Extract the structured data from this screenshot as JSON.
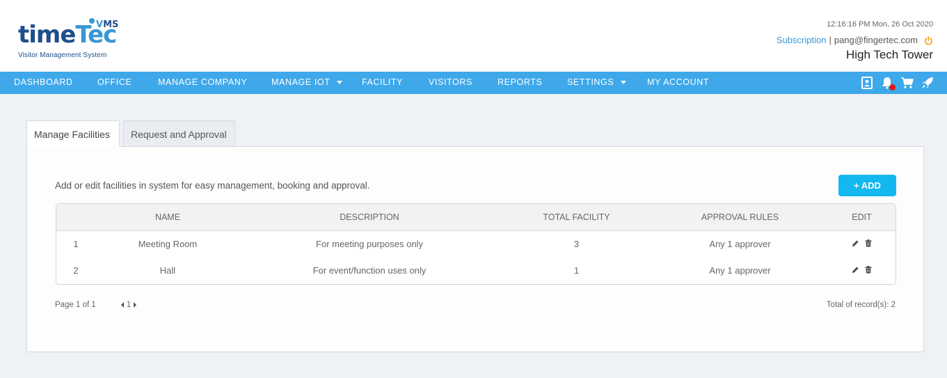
{
  "logo": {
    "time": "time",
    "tec": "Tec",
    "vms_v": "V",
    "vms_ms": "MS",
    "tagline": "Visitor Management System"
  },
  "header": {
    "datetime": "12:16:16 PM  Mon, 26 Oct 2020",
    "subscription": "Subscription",
    "separator": "|",
    "email": "pang@fingertec.com",
    "building": "High Tech Tower"
  },
  "nav": {
    "items": [
      "DASHBOARD",
      "OFFICE",
      "MANAGE COMPANY",
      "MANAGE IOT",
      "FACILITY",
      "VISITORS",
      "REPORTS",
      "SETTINGS",
      "MY ACCOUNT"
    ],
    "icons": [
      "contact-card-icon",
      "notification-bell-icon",
      "cart-icon",
      "rocket-icon"
    ]
  },
  "tabs": [
    "Manage Facilities",
    "Request and Approval"
  ],
  "intro": "Add or edit facilities in system for easy management, booking and approval.",
  "add_button": "+ ADD",
  "table": {
    "headers": [
      "",
      "NAME",
      "DESCRIPTION",
      "TOTAL FACILITY",
      "APPROVAL RULES",
      "EDIT"
    ],
    "rows": [
      [
        "1",
        "Meeting Room",
        "For meeting purposes only",
        "3",
        "Any 1 approver"
      ],
      [
        "2",
        "Hall",
        "For event/function uses only",
        "1",
        "Any 1 approver"
      ]
    ]
  },
  "pager": {
    "page_label": "Page 1 of 1",
    "current": "1"
  },
  "total_records": "Total of record(s): 2",
  "colors": {
    "nav": "#3ea8ea",
    "accent": "#14b8f0",
    "brand_dark": "#1f4e8c",
    "notif": "#e0161b",
    "power": "#f0a500"
  }
}
